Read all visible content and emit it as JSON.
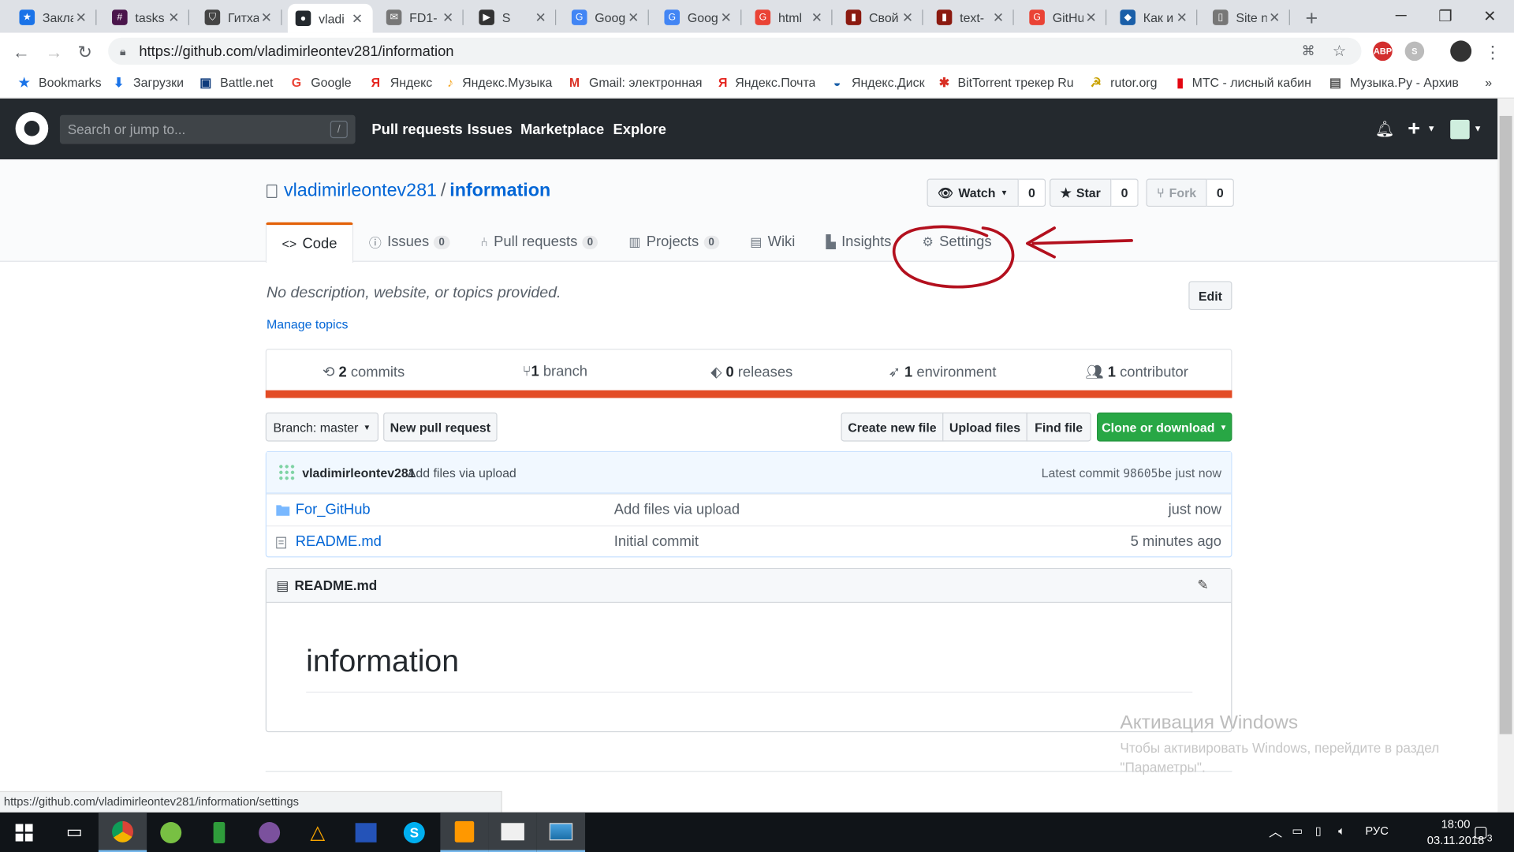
{
  "browser": {
    "tabs": [
      {
        "title": "Закла",
        "color": "#1a73e8",
        "glyph": "★"
      },
      {
        "title": "tasks",
        "color": "#4a154b",
        "glyph": "#"
      },
      {
        "title": "Гитха",
        "color": "#444",
        "glyph": "⛉"
      },
      {
        "title": "vladi",
        "color": "#24292e",
        "glyph": "●",
        "active": true
      },
      {
        "title": "FD1-",
        "color": "#777",
        "glyph": "✉"
      },
      {
        "title": "S",
        "color": "#333",
        "glyph": "▶"
      },
      {
        "title": "Goog",
        "color": "#4285f4",
        "glyph": "G"
      },
      {
        "title": "Goog",
        "color": "#4285f4",
        "glyph": "G"
      },
      {
        "title": "html",
        "color": "#ea4335",
        "glyph": "G"
      },
      {
        "title": "Свой",
        "color": "#8b1a10",
        "glyph": "▮"
      },
      {
        "title": "text-",
        "color": "#8b1a10",
        "glyph": "▮"
      },
      {
        "title": "GitHu",
        "color": "#ea4335",
        "glyph": "G"
      },
      {
        "title": "Как и",
        "color": "#1a5fa8",
        "glyph": "◆"
      },
      {
        "title": "Site n",
        "color": "#777",
        "glyph": "▯"
      }
    ],
    "url": "https://github.com/vladimirleontev281/information",
    "bookmarks": [
      {
        "label": "Bookmarks",
        "icon": "★",
        "color": "#1a73e8"
      },
      {
        "label": "Загрузки",
        "icon": "⬇",
        "color": "#1a73e8"
      },
      {
        "label": "Battle.net",
        "icon": "▣",
        "color": "#0e3b7c"
      },
      {
        "label": "Google",
        "icon": "G",
        "color": "#ea4335"
      },
      {
        "label": "Яндекс",
        "icon": "Я",
        "color": "#e52620"
      },
      {
        "label": "Яндекс.Музыка",
        "icon": "♪",
        "color": "#f5a623"
      },
      {
        "label": "Gmail: электронная",
        "icon": "M",
        "color": "#d93025"
      },
      {
        "label": "Яндекс.Почта",
        "icon": "Я",
        "color": "#e52620"
      },
      {
        "label": "Яндекс.Диск",
        "icon": "◒",
        "color": "#1a5fa8"
      },
      {
        "label": "BitTorrent трекер Ru",
        "icon": "✱",
        "color": "#d93025"
      },
      {
        "label": "rutor.org",
        "icon": "☭",
        "color": "#c9a100"
      },
      {
        "label": "МТС - лисный кабин",
        "icon": "▮",
        "color": "#e30611"
      },
      {
        "label": "Музыка.Ру - Архив",
        "icon": "▤",
        "color": "#555"
      }
    ],
    "status_url": "https://github.com/vladimirleontev281/information/settings"
  },
  "github": {
    "search_placeholder": "Search or jump to...",
    "search_key": "/",
    "nav": [
      "Pull requests",
      "Issues",
      "Marketplace",
      "Explore"
    ]
  },
  "repo": {
    "owner": "vladimirleontev281",
    "separator": "/",
    "name": "information",
    "watch": {
      "label": "Watch",
      "count": "0"
    },
    "star": {
      "label": "Star",
      "count": "0"
    },
    "fork": {
      "label": "Fork",
      "count": "0"
    },
    "tabs": {
      "code": "Code",
      "issues": "Issues",
      "issues_count": "0",
      "pulls": "Pull requests",
      "pulls_count": "0",
      "projects": "Projects",
      "projects_count": "0",
      "wiki": "Wiki",
      "insights": "Insights",
      "settings": "Settings"
    },
    "description": "No description, website, or topics provided.",
    "manage_topics": "Manage topics",
    "edit": "Edit",
    "summary": {
      "commits_num": "2",
      "commits_label": "commits",
      "branch_num": "1",
      "branch_label": "branch",
      "releases_num": "0",
      "releases_label": "releases",
      "env_num": "1",
      "env_label": "environment",
      "contrib_num": "1",
      "contrib_label": "contributor"
    },
    "lang_color": "#e34c26",
    "branch_button": "Branch: master",
    "new_pr": "New pull request",
    "create_file": "Create new file",
    "upload_files": "Upload files",
    "find_file": "Find file",
    "clone": "Clone or download",
    "commit": {
      "author": "vladimirleontev281",
      "message": "Add files via upload",
      "latest_label": "Latest commit",
      "sha": "98605be",
      "time": "just now"
    },
    "files": [
      {
        "name": "For_GitHub",
        "type": "folder",
        "message": "Add files via upload",
        "age": "just now"
      },
      {
        "name": "README.md",
        "type": "file",
        "message": "Initial commit",
        "age": "5 minutes ago"
      }
    ],
    "readme": {
      "filename": "README.md",
      "heading": "information"
    }
  },
  "watermark": {
    "title": "Активация Windows",
    "line1": "Чтобы активировать Windows, перейдите в раздел",
    "line2": "\"Параметры\"."
  },
  "taskbar": {
    "lang": "РУС",
    "time": "18:00",
    "date": "03.11.2018",
    "notifications": "3"
  },
  "annotation_color": "#b3101e"
}
